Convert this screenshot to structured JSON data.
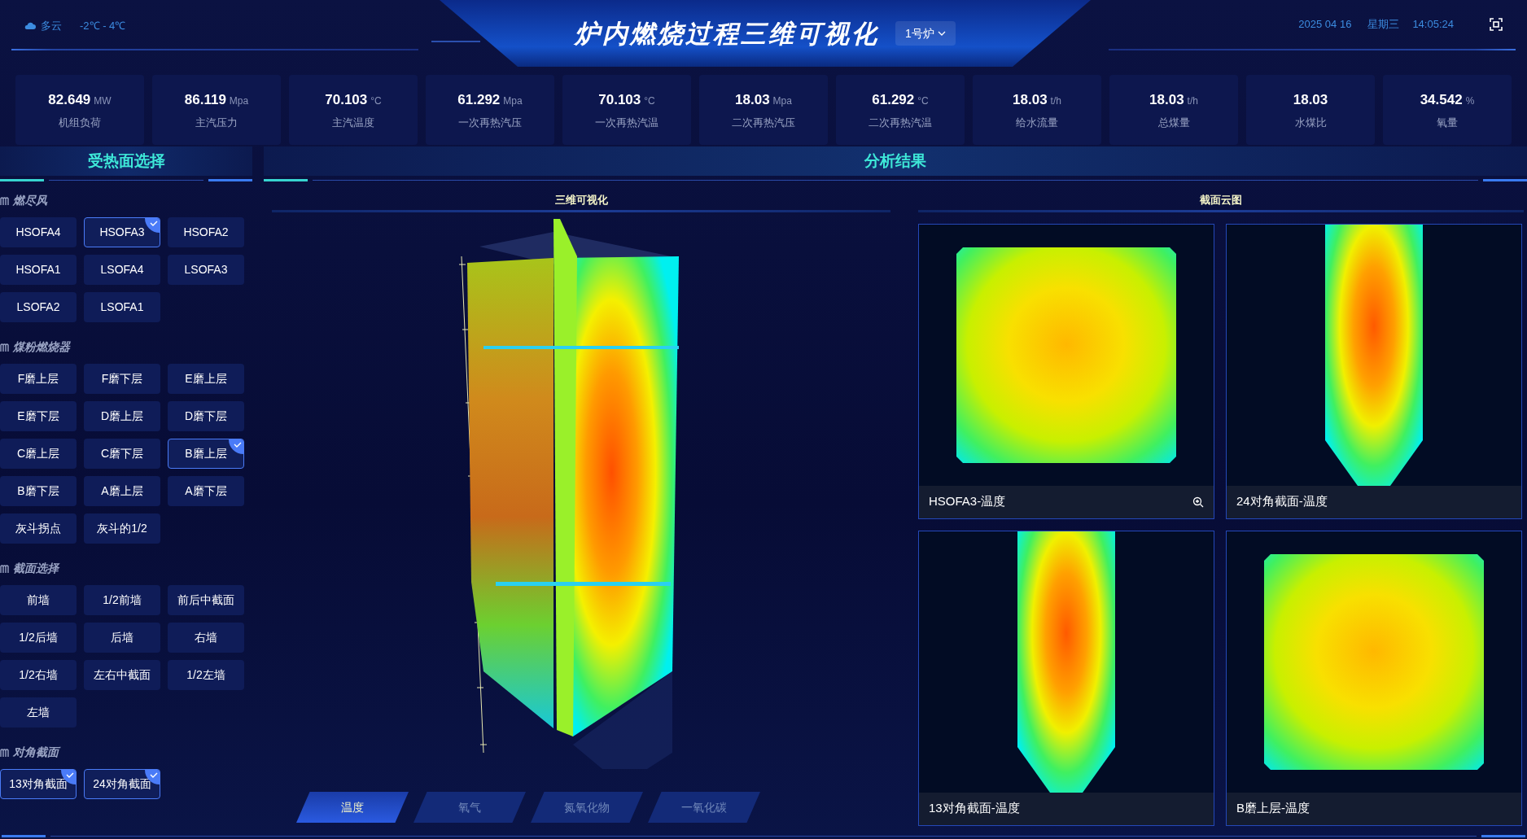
{
  "header": {
    "weather": {
      "condition": "多云",
      "temperature": "-2℃ - 4℃"
    },
    "title": "炉内燃烧过程三维可视化",
    "furnace": "1号炉",
    "date": "2025 04 16",
    "weekday": "星期三",
    "time": "14:05:24"
  },
  "kpis": [
    {
      "value": "82.649",
      "unit": "MW",
      "label": "机组负荷"
    },
    {
      "value": "86.119",
      "unit": "Mpa",
      "label": "主汽压力"
    },
    {
      "value": "70.103",
      "unit": "°C",
      "label": "主汽温度"
    },
    {
      "value": "61.292",
      "unit": "Mpa",
      "label": "一次再热汽压"
    },
    {
      "value": "70.103",
      "unit": "°C",
      "label": "一次再热汽温"
    },
    {
      "value": "18.03",
      "unit": "Mpa",
      "label": "二次再热汽压"
    },
    {
      "value": "61.292",
      "unit": "°C",
      "label": "二次再热汽温"
    },
    {
      "value": "18.03",
      "unit": "t/h",
      "label": "给水流量"
    },
    {
      "value": "18.03",
      "unit": "t/h",
      "label": "总煤量"
    },
    {
      "value": "18.03",
      "label": "水煤比"
    },
    {
      "value": "34.542",
      "unit": "%",
      "label": "氧量"
    }
  ],
  "left_panel": {
    "title": "受热面选择",
    "groups": [
      {
        "title": "燃尽风",
        "buttons": [
          {
            "label": "HSOFA4",
            "selected": false
          },
          {
            "label": "HSOFA3",
            "selected": true
          },
          {
            "label": "HSOFA2",
            "selected": false
          },
          {
            "label": "HSOFA1",
            "selected": false
          },
          {
            "label": "LSOFA4",
            "selected": false
          },
          {
            "label": "LSOFA3",
            "selected": false
          },
          {
            "label": "LSOFA2",
            "selected": false
          },
          {
            "label": "LSOFA1",
            "selected": false
          }
        ]
      },
      {
        "title": "煤粉燃烧器",
        "buttons": [
          {
            "label": "F磨上层",
            "selected": false
          },
          {
            "label": "F磨下层",
            "selected": false
          },
          {
            "label": "E磨上层",
            "selected": false
          },
          {
            "label": "E磨下层",
            "selected": false
          },
          {
            "label": "D磨上层",
            "selected": false
          },
          {
            "label": "D磨下层",
            "selected": false
          },
          {
            "label": "C磨上层",
            "selected": false
          },
          {
            "label": "C磨下层",
            "selected": false
          },
          {
            "label": "B磨上层",
            "selected": true
          },
          {
            "label": "B磨下层",
            "selected": false
          },
          {
            "label": "A磨上层",
            "selected": false
          },
          {
            "label": "A磨下层",
            "selected": false
          },
          {
            "label": "灰斗拐点",
            "selected": false
          },
          {
            "label": "灰斗的1/2",
            "selected": false
          }
        ]
      },
      {
        "title": "截面选择",
        "buttons": [
          {
            "label": "前墙",
            "selected": false
          },
          {
            "label": "1/2前墙",
            "selected": false
          },
          {
            "label": "前后中截面",
            "selected": false
          },
          {
            "label": "1/2后墙",
            "selected": false
          },
          {
            "label": "后墙",
            "selected": false
          },
          {
            "label": "右墙",
            "selected": false
          },
          {
            "label": "1/2右墙",
            "selected": false
          },
          {
            "label": "左右中截面",
            "selected": false
          },
          {
            "label": "1/2左墙",
            "selected": false
          },
          {
            "label": "左墙",
            "selected": false
          }
        ]
      },
      {
        "title": "对角截面",
        "buttons": [
          {
            "label": "13对角截面",
            "selected": true
          },
          {
            "label": "24对角截面",
            "selected": true
          }
        ]
      }
    ]
  },
  "analysis": {
    "title": "分析结果",
    "view_3d": {
      "title": "三维可视化",
      "tabs": [
        {
          "label": "温度",
          "selected": true
        },
        {
          "label": "氧气",
          "selected": false
        },
        {
          "label": "氮氧化物",
          "selected": false
        },
        {
          "label": "一氧化碳",
          "selected": false
        }
      ]
    },
    "sections": {
      "title": "截面云图",
      "panels": [
        {
          "kind": "square",
          "caption": "HSOFA3-温度",
          "zoom_icon": true
        },
        {
          "kind": "tall",
          "caption": "24对角截面-温度",
          "zoom_icon": false
        },
        {
          "kind": "tall",
          "caption": "13对角截面-温度",
          "zoom_icon": false
        },
        {
          "kind": "square",
          "caption": "B磨上层-温度",
          "zoom_icon": false
        }
      ]
    }
  }
}
